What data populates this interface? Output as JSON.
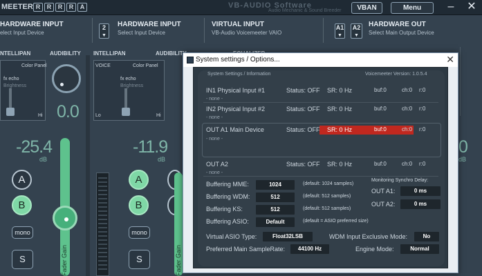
{
  "topbar": {
    "app_name": "MEETER",
    "r_boxes": [
      "R",
      "R",
      "R",
      "R",
      "A"
    ],
    "watermark": "VB-AUDIO Software",
    "watermark_sub": "Audio Mechanic & Sound Breeder",
    "vban_label": "VBAN",
    "menu_label": "Menu",
    "minimize_glyph": "–",
    "close_glyph": "✕"
  },
  "headers": {
    "hw_input_1": {
      "title": "HARDWARE INPUT",
      "subtitle": "elect Input Device"
    },
    "hw_input_2": {
      "num": "2",
      "title": "HARDWARE INPUT",
      "subtitle": "Select Input Device"
    },
    "virtual_input": {
      "title": "VIRTUAL INPUT",
      "subtitle": "VB-Audio Voicemeeter VAIO"
    },
    "hw_out": {
      "a1": "A1",
      "a2": "A2",
      "title": "HARDWARE OUT",
      "subtitle": "Select Main Output Device"
    }
  },
  "strips": {
    "s1": {
      "intellipan": "NTELLIPAN",
      "audibility": "AUDIBILITY",
      "color_panel": "Color Panel",
      "fx": "fx echo",
      "brightness": "Brightness",
      "hi": "Hi",
      "knob_value": "0.0",
      "gain": "-25.4",
      "db": "dB",
      "bus_a": "A",
      "bus_b": "B",
      "mono": "mono",
      "solo": "S",
      "fader_label": "Fader Gain"
    },
    "s2": {
      "intellipan": "INTELLIPAN",
      "audibility": "AUDIBILITY",
      "voice": "VOICE",
      "color_panel": "Color Panel",
      "fx": "fx echo",
      "brightness": "Brightness",
      "lo": "Lo",
      "hi": "Hi",
      "gain": "-11.9",
      "db": "dB",
      "bus_a": "A",
      "bus_b": "B",
      "mono": "mono",
      "solo": "S",
      "fader_label": "Fader Gain"
    },
    "s3": {
      "equalizer": "EQUALIZER"
    }
  },
  "right_strip": {
    "value": "0",
    "db": "dB"
  },
  "dialog": {
    "title": "System settings / Options...",
    "close_glyph": "✕",
    "section_header": "System Settings / Information",
    "version": "Voicemeeter Version: 1.0.5.4",
    "rows": [
      {
        "name": "IN1 Physical Input #1",
        "status": "Status: OFF",
        "sr": "SR: 0 Hz",
        "buf": "buf:0",
        "ch": "ch:0",
        "r": "r:0",
        "device": "- none -"
      },
      {
        "name": "IN2 Physical Input #2",
        "status": "Status: OFF",
        "sr": "SR: 0 Hz",
        "buf": "buf:0",
        "ch": "ch:0",
        "r": "r:0",
        "device": "- none -"
      },
      {
        "name": "OUT A1 Main Device",
        "status": "Status: OFF",
        "sr": "SR: 0 Hz",
        "buf": "buf:0",
        "ch": "ch:0",
        "r": "r:0",
        "device": "- none -"
      },
      {
        "name": "OUT A2",
        "status": "Status: OFF",
        "sr": "SR: 0 Hz",
        "buf": "buf:0",
        "ch": "ch:0",
        "r": "r:0",
        "device": "- none -"
      }
    ],
    "buffering": [
      {
        "label": "Buffering MME:",
        "value": "1024",
        "note": "(default: 1024 samples)"
      },
      {
        "label": "Buffering WDM:",
        "value": "512",
        "note": "(default: 512 samples)"
      },
      {
        "label": "Buffering KS:",
        "value": "512",
        "note": "(default: 512 samples)"
      },
      {
        "label": "Buffering ASIO:",
        "value": "Default",
        "note": "(default = ASIO preferred size)"
      }
    ],
    "monitoring": {
      "title": "Monitoring Synchro Delay:",
      "out_a1_label": "OUT A1:",
      "out_a1_value": "0 ms",
      "out_a2_label": "OUT A2:",
      "out_a2_value": "0 ms"
    },
    "asio_type_label": "Virtual ASIO Type:",
    "asio_type_value": "Float32LSB",
    "wdm_exclusive_label": "WDM Input Exclusive Mode:",
    "wdm_exclusive_value": "No",
    "samplerate_label": "Preferred Main SampleRate:",
    "samplerate_value": "44100 Hz",
    "engine_label": "Engine Mode:",
    "engine_value": "Normal"
  },
  "colors": {
    "accent_green": "#5ec28d",
    "error_red": "#c0281f",
    "gain_text": "#7fb5a8"
  }
}
